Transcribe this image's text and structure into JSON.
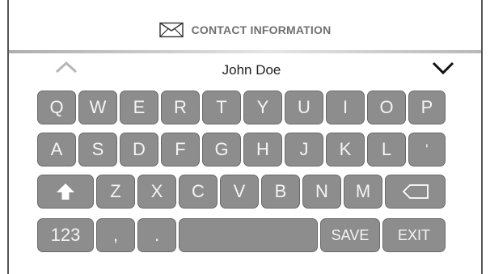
{
  "header": {
    "title": "CONTACT INFORMATION",
    "icon": "envelope-icon"
  },
  "contact": {
    "name": "John Doe"
  },
  "navigation": {
    "up_icon": "chevron-up-icon",
    "down_icon": "chevron-down-icon"
  },
  "keyboard": {
    "row1": [
      "Q",
      "W",
      "E",
      "R",
      "T",
      "Y",
      "U",
      "I",
      "O",
      "P"
    ],
    "row2": [
      "A",
      "S",
      "D",
      "F",
      "G",
      "H",
      "J",
      "K",
      "L",
      "‘"
    ],
    "row3": [
      "Z",
      "X",
      "C",
      "V",
      "B",
      "N",
      "M"
    ],
    "shift_icon": "shift-arrow-icon",
    "backspace_icon": "backspace-icon",
    "row4": {
      "numbers": "123",
      "comma": ",",
      "period": ".",
      "save": "SAVE",
      "exit": "EXIT"
    }
  },
  "colors": {
    "key_fill": "#8d8d8d",
    "key_text": "#f4f4f4",
    "header_text": "#707070"
  }
}
